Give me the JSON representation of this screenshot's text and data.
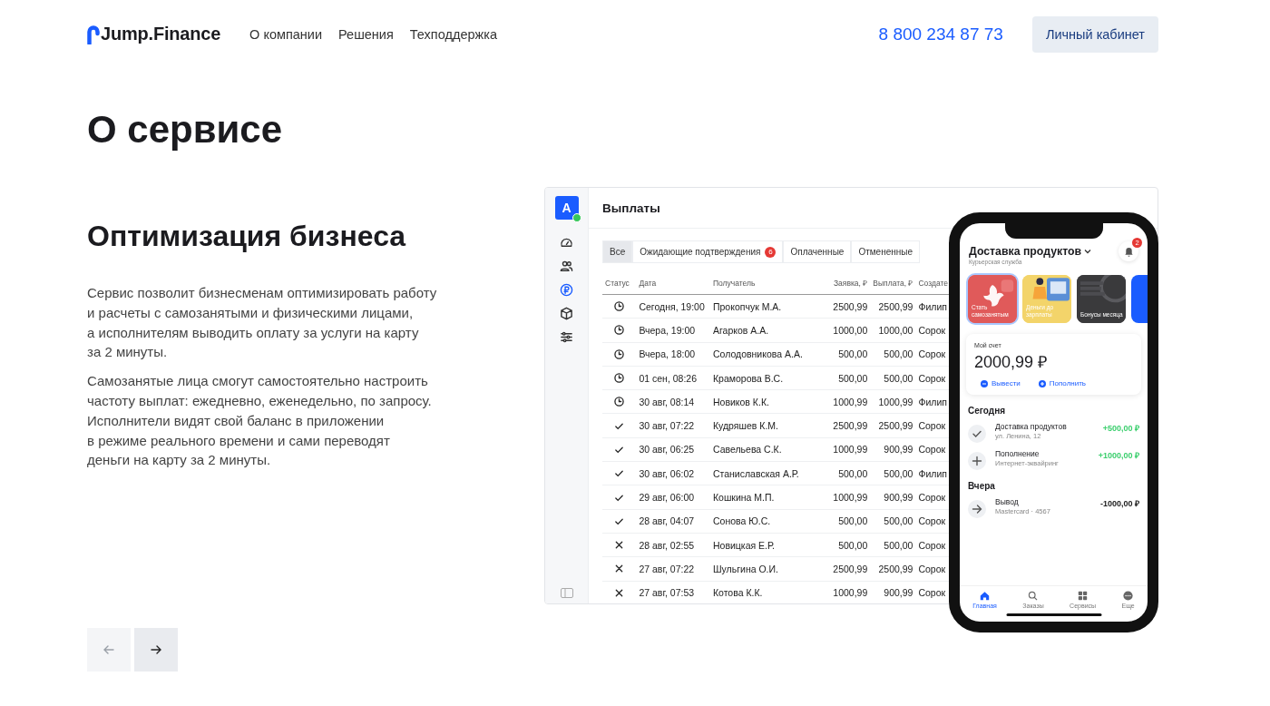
{
  "header": {
    "logo": "Jump.Finance",
    "nav": [
      "О компании",
      "Решения",
      "Техподдержка"
    ],
    "phone": "8 800 234 87 73",
    "cabinet_button": "Личный кабинет"
  },
  "page_title": "О сервисе",
  "section": {
    "heading": "Оптимизация бизнеса",
    "paragraphs": [
      "Сервис позволит бизнесменам оптимизировать работу\nи расчеты с самозанятыми и физическими лицами,\nа исполнителям выводить оплату за услуги на карту\nза 2 минуты.",
      "Самозанятые лица смогут самостоятельно настроить\nчастоту выплат: ежедневно, еженедельно, по запросу.\nИсполнители видят свой баланс в приложении\nв режиме реального времени и сами переводят\nденьги на карту за 2 минуты."
    ]
  },
  "carousel": [
    {
      "kind": "prev",
      "disabled": true
    },
    {
      "kind": "next",
      "disabled": false
    }
  ],
  "dashboard": {
    "avatar": "A",
    "sidebar": [
      {
        "kind": "gauge",
        "selected": false
      },
      {
        "kind": "users",
        "selected": false
      },
      {
        "kind": "ruble",
        "selected": true
      },
      {
        "kind": "box",
        "selected": false
      },
      {
        "kind": "sliders",
        "selected": false
      }
    ],
    "title": "Выплаты",
    "tabs": [
      {
        "label": "Все",
        "selected": true
      },
      {
        "label": "Ожидающие подтверждения",
        "badge": "6",
        "selected": false
      },
      {
        "label": "Оплаченные",
        "selected": false
      },
      {
        "label": "Отмененные",
        "selected": false
      }
    ],
    "columns": [
      "Статус",
      "Дата",
      "Получатель",
      "Заявка, ₽",
      "Выплата, ₽",
      "Создате"
    ],
    "rows": [
      {
        "kind": "pending",
        "date": "Сегодня, 19:00",
        "recipient": "Прокопчук М.А.",
        "request": "2500,99",
        "payout": "2500,99",
        "creator": "Филип"
      },
      {
        "kind": "pending",
        "date": "Вчера, 19:00",
        "recipient": "Агарков А.А.",
        "request": "1000,00",
        "payout": "1000,00",
        "creator": "Сорок"
      },
      {
        "kind": "pending",
        "date": "Вчера, 18:00",
        "recipient": "Солодовникова А.А.",
        "request": "500,00",
        "payout": "500,00",
        "creator": "Сорок"
      },
      {
        "kind": "pending",
        "date": "01 сен, 08:26",
        "recipient": "Краморова В.С.",
        "request": "500,00",
        "payout": "500,00",
        "creator": "Сорок"
      },
      {
        "kind": "pending",
        "date": "30 авг, 08:14",
        "recipient": "Новиков К.К.",
        "request": "1000,99",
        "payout": "1000,99",
        "creator": "Филип"
      },
      {
        "kind": "paid",
        "date": "30 авг, 07:22",
        "recipient": "Кудряшев К.М.",
        "request": "2500,99",
        "payout": "2500,99",
        "creator": "Сорок"
      },
      {
        "kind": "paid",
        "date": "30 авг, 06:25",
        "recipient": "Савельева С.К.",
        "request": "1000,99",
        "payout": "900,99",
        "creator": "Сорок"
      },
      {
        "kind": "paid",
        "date": "30 авг, 06:02",
        "recipient": "Станиславская А.Р.",
        "request": "500,00",
        "payout": "500,00",
        "creator": "Филип"
      },
      {
        "kind": "paid",
        "date": "29 авг, 06:00",
        "recipient": "Кошкина М.П.",
        "request": "1000,99",
        "payout": "900,99",
        "creator": "Сорок"
      },
      {
        "kind": "paid",
        "date": "28 авг, 04:07",
        "recipient": "Сонова Ю.С.",
        "request": "500,00",
        "payout": "500,00",
        "creator": "Сорок"
      },
      {
        "kind": "cancelled",
        "date": "28 авг, 02:55",
        "recipient": "Новицкая Е.Р.",
        "request": "500,00",
        "payout": "500,00",
        "creator": "Сорок"
      },
      {
        "kind": "cancelled",
        "date": "27 авг, 07:22",
        "recipient": "Шульгина О.И.",
        "request": "2500,99",
        "payout": "2500,99",
        "creator": "Сорок"
      },
      {
        "kind": "cancelled",
        "date": "27 авг, 07:53",
        "recipient": "Котова К.К.",
        "request": "1000,99",
        "payout": "900,99",
        "creator": "Сорок"
      }
    ]
  },
  "phone_app": {
    "title": "Доставка продуктов",
    "subtitle": "Курьерская служба",
    "notifications": "2",
    "stories": [
      {
        "title": "Стать самозанятым",
        "color": "#e05a5a"
      },
      {
        "title": "Деньги до зарплаты",
        "color": "#f3d46a"
      },
      {
        "title": "Бонусы месяца",
        "color": "#3a3a3c"
      },
      {
        "color": "#1a5cff"
      }
    ],
    "account": {
      "label": "Мой счет",
      "balance": "2000,99 ₽",
      "actions": [
        "Вывести",
        "Пополнить"
      ]
    },
    "groups": [
      {
        "title": "Сегодня",
        "items": [
          {
            "kind": "check",
            "title": "Доставка продуктов",
            "subtitle": "ул. Ленина, 12",
            "amount": "+500,00 ₽",
            "color": "#3ccf6e"
          },
          {
            "kind": "plus",
            "title": "Пополнение",
            "subtitle": "Интернет-эквайринг",
            "amount": "+1000,00 ₽",
            "color": "#3ccf6e"
          }
        ]
      },
      {
        "title": "Вчера",
        "items": [
          {
            "kind": "arrow",
            "title": "Вывод",
            "subtitle": "Mastercard · 4567",
            "amount": "-1000,00 ₽",
            "color": "#222222"
          }
        ]
      }
    ],
    "tabbar": [
      {
        "kind": "home",
        "label": "Главная",
        "selected": true
      },
      {
        "kind": "search",
        "label": "Заказы",
        "selected": false
      },
      {
        "kind": "grid",
        "label": "Сервисы",
        "selected": false
      },
      {
        "kind": "more",
        "label": "Еще",
        "selected": false
      }
    ]
  }
}
